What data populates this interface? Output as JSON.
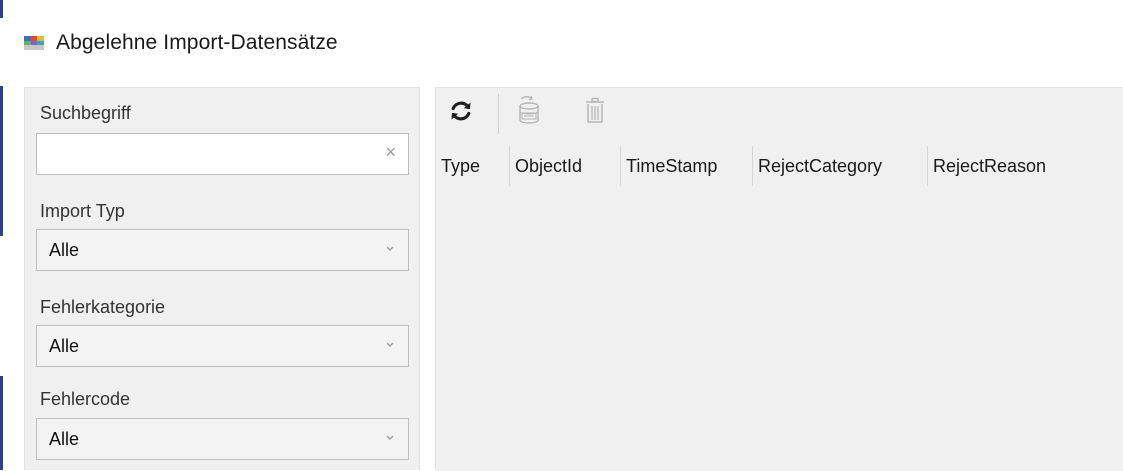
{
  "window": {
    "title": "Abgelehne Import-Datensätze",
    "icon": "app-logo-icon"
  },
  "filters": {
    "search": {
      "label": "Suchbegriff",
      "value": "",
      "clear_glyph": "×"
    },
    "import_type": {
      "label": "Import Typ",
      "value": "Alle"
    },
    "error_category": {
      "label": "Fehlerkategorie",
      "value": "Alle"
    },
    "error_code": {
      "label": "Fehlercode",
      "value": "Alle"
    }
  },
  "toolbar": {
    "refresh_icon": "refresh-icon",
    "database_icon": "database-refresh-icon",
    "delete_icon": "trash-icon"
  },
  "grid": {
    "columns": [
      "Type",
      "ObjectId",
      "TimeStamp",
      "RejectCategory",
      "RejectReason"
    ],
    "rows": []
  },
  "colors": {
    "panel_bg": "#f0f0f0",
    "disabled_icon": "#b5b5b5",
    "accent_edge": "#2f3fa0"
  }
}
